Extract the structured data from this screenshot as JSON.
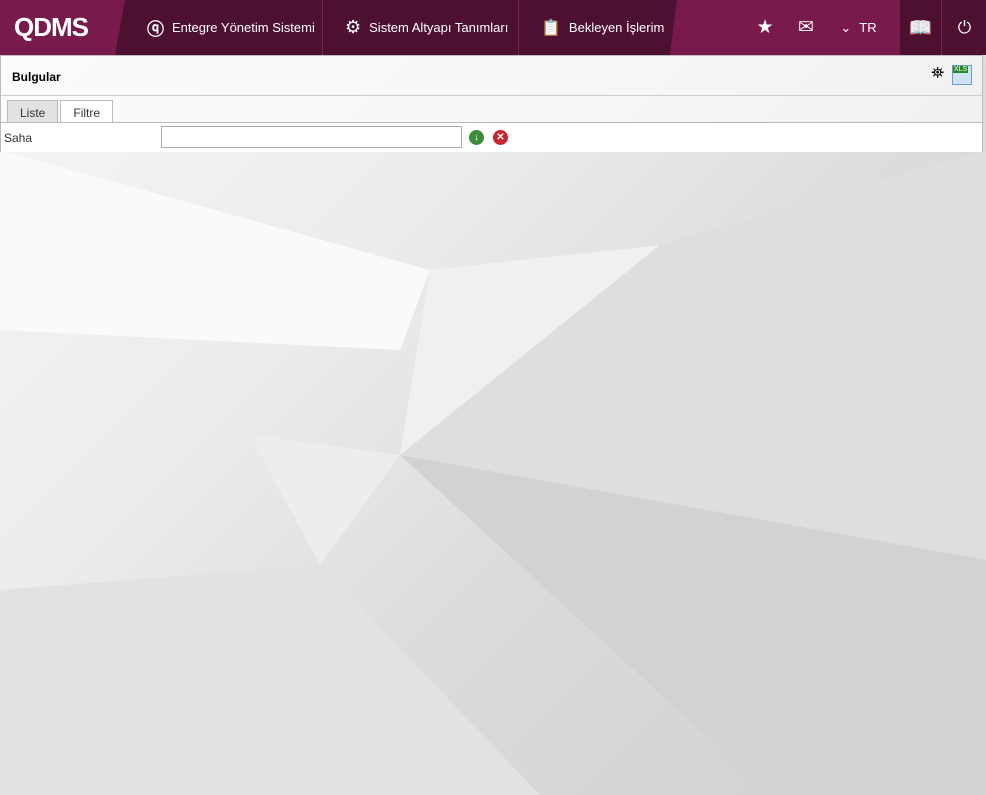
{
  "header": {
    "logo": "QDMS",
    "nav": [
      {
        "label": "Entegre Yönetim Sistemi",
        "icon": "q-icon"
      },
      {
        "label": "Sistem Altyapı Tanımları",
        "icon": "gear-icon"
      },
      {
        "label": "Bekleyen İşlerim",
        "icon": "clipboard-icon"
      }
    ],
    "language": "TR"
  },
  "panel": {
    "title": "Bulgular",
    "tabs": [
      "Liste",
      "Filtre"
    ],
    "active_tab": "Filtre",
    "field_label": "Saha",
    "field_value": ""
  }
}
